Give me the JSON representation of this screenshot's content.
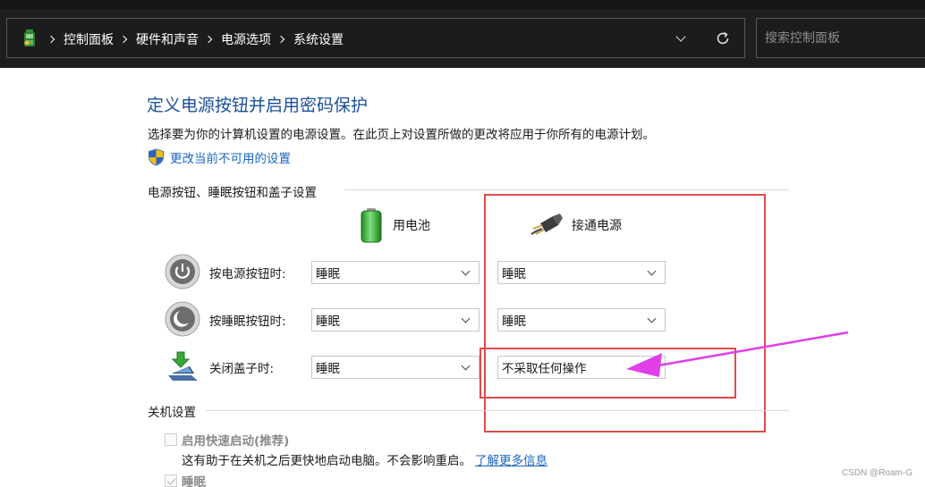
{
  "address_bar": {
    "breadcrumbs": [
      "控制面板",
      "硬件和声音",
      "电源选项",
      "系统设置"
    ],
    "search_placeholder": "搜索控制面板"
  },
  "page": {
    "title": "定义电源按钮并启用密码保护",
    "description": "选择要为你的计算机设置的电源设置。在此页上对设置所做的更改将应用于你所有的电源计划。",
    "change_link": "更改当前不可用的设置"
  },
  "buttons_section": {
    "header": "电源按钮、睡眠按钮和盖子设置",
    "battery_label": "用电池",
    "plugged_label": "接通电源",
    "rows": [
      {
        "label": "按电源按钮时:",
        "battery": "睡眠",
        "plugged": "睡眠"
      },
      {
        "label": "按睡眠按钮时:",
        "battery": "睡眠",
        "plugged": "睡眠"
      },
      {
        "label": "关闭盖子时:",
        "battery": "睡眠",
        "plugged": "不采取任何操作"
      }
    ]
  },
  "shutdown_section": {
    "header": "关机设置",
    "fast_startup_label": "启用快速启动(推荐)",
    "fast_startup_checked": false,
    "fast_startup_help": "这有助于在关机之后更快地启动电脑。不会影响重启。",
    "learn_more": "了解更多信息",
    "sleep_label": "睡眠",
    "sleep_checked": true
  },
  "annotations": {
    "box_color": "#e04b4b",
    "arrow_color": "#e040e8"
  },
  "watermark": "CSDN @Roam-G"
}
